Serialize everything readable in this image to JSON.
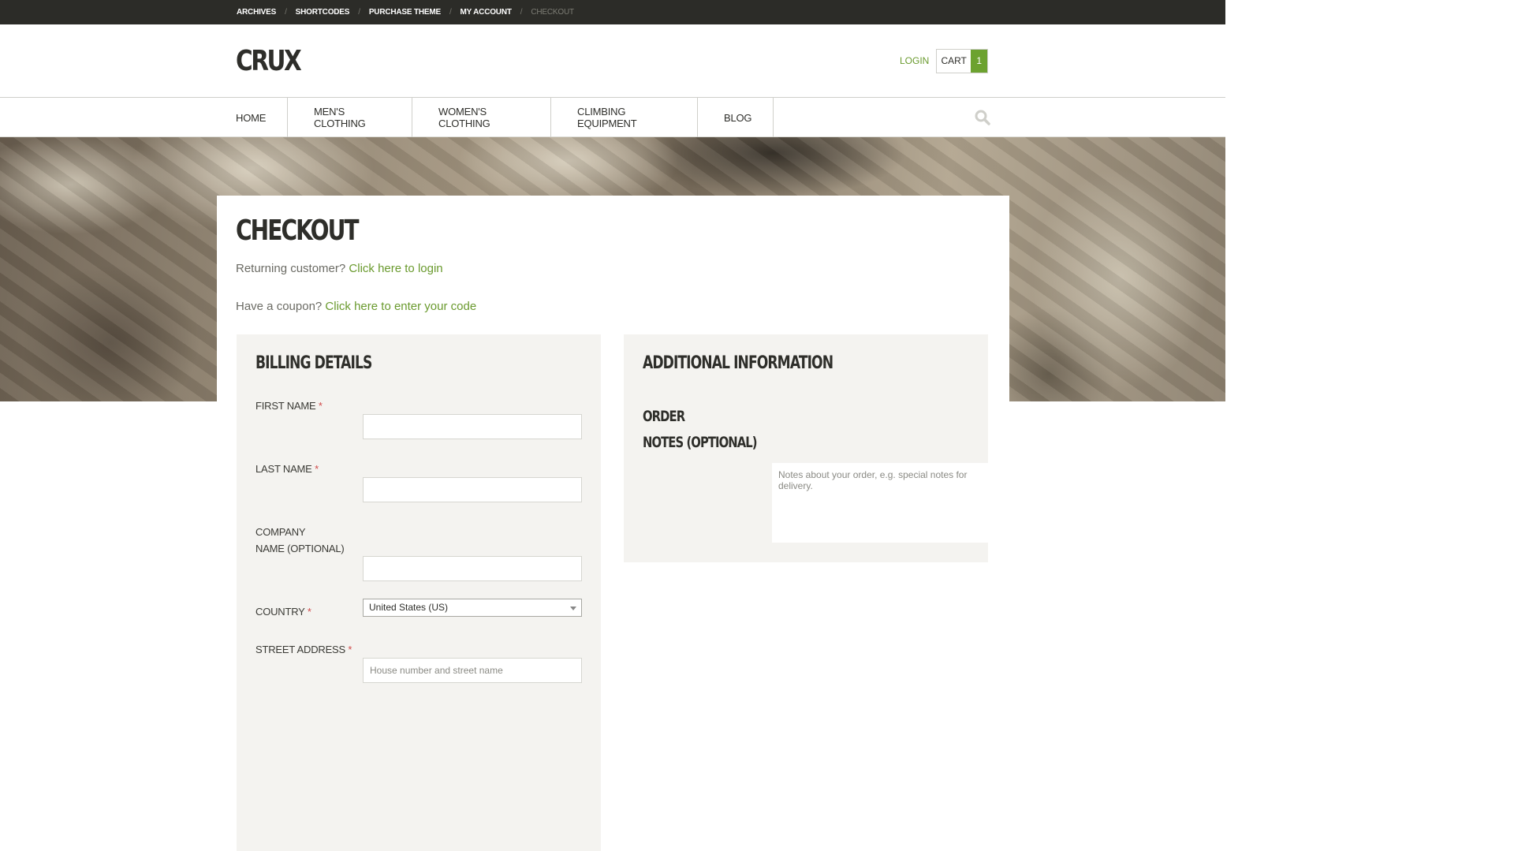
{
  "topbar": {
    "links": [
      "ARCHIVES",
      "SHORTCODES",
      "PURCHASE THEME",
      "MY ACCOUNT"
    ],
    "separator": "/",
    "current": "CHECKOUT"
  },
  "header": {
    "logo": "CRUX",
    "login": "LOGIN",
    "cart_label": "CART",
    "cart_count": "1"
  },
  "nav": {
    "items": [
      "HOME",
      "MEN'S CLOTHING",
      "WOMEN'S CLOTHING",
      "CLIMBING EQUIPMENT",
      "BLOG"
    ],
    "search_icon": "search-icon"
  },
  "page": {
    "title": "CHECKOUT",
    "returning_text": "Returning customer?",
    "returning_link": "Click here to login",
    "coupon_text": "Have a coupon?",
    "coupon_link": "Click here to enter your code"
  },
  "billing": {
    "title": "BILLING DETAILS",
    "required_mark": "*",
    "first_name_label": "FIRST NAME",
    "first_name_value": "",
    "last_name_label": "LAST NAME",
    "last_name_value": "",
    "company_label_1": "COMPANY",
    "company_label_2": "NAME (OPTIONAL)",
    "company_value": "",
    "country_label": "COUNTRY",
    "country_value": "United States (US)",
    "street_label": "STREET ADDRESS",
    "street_placeholder": "House number and street name"
  },
  "additional": {
    "title": "ADDITIONAL INFORMATION",
    "notes_label_1": "ORDER",
    "notes_label_2": "NOTES (OPTIONAL)",
    "notes_placeholder": "Notes about your order, e.g. special notes for delivery."
  },
  "colors": {
    "accent_green": "#6ca22f",
    "link_green": "#6a9a2e",
    "topbar_bg": "#2c2c28",
    "panel_bg": "#f4f3f0",
    "required_red": "#d04a4a"
  }
}
